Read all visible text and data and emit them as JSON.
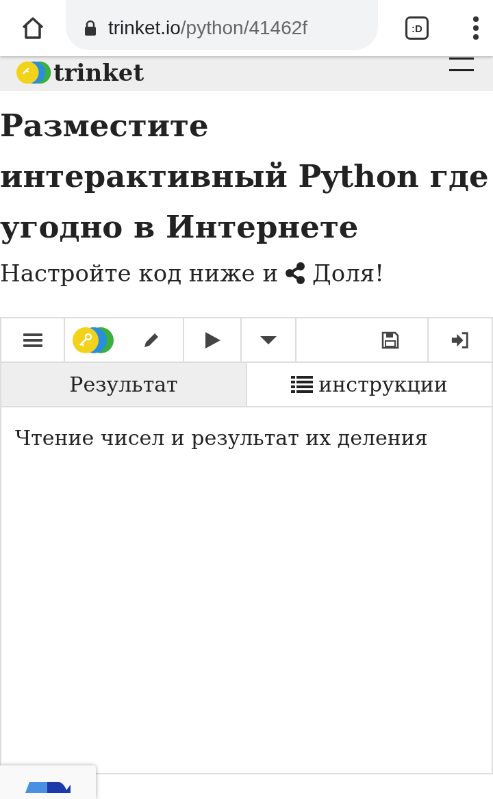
{
  "browser": {
    "url_host": "trinket.io",
    "url_path": "/python/41462f",
    "tab_badge": ":D"
  },
  "site_header": {
    "brand": "trinket"
  },
  "heading": "Разместите интерактивный Python где угодно в Интернете",
  "subtitle": {
    "before": "Настройте код ниже и",
    "after": "Доля!"
  },
  "editor": {
    "tabs": [
      {
        "label": "Результат",
        "kind": "output",
        "selected": false
      },
      {
        "label": "инструкции",
        "kind": "instructions",
        "selected": true
      }
    ],
    "content": "Чтение чисел и результат их деления"
  }
}
